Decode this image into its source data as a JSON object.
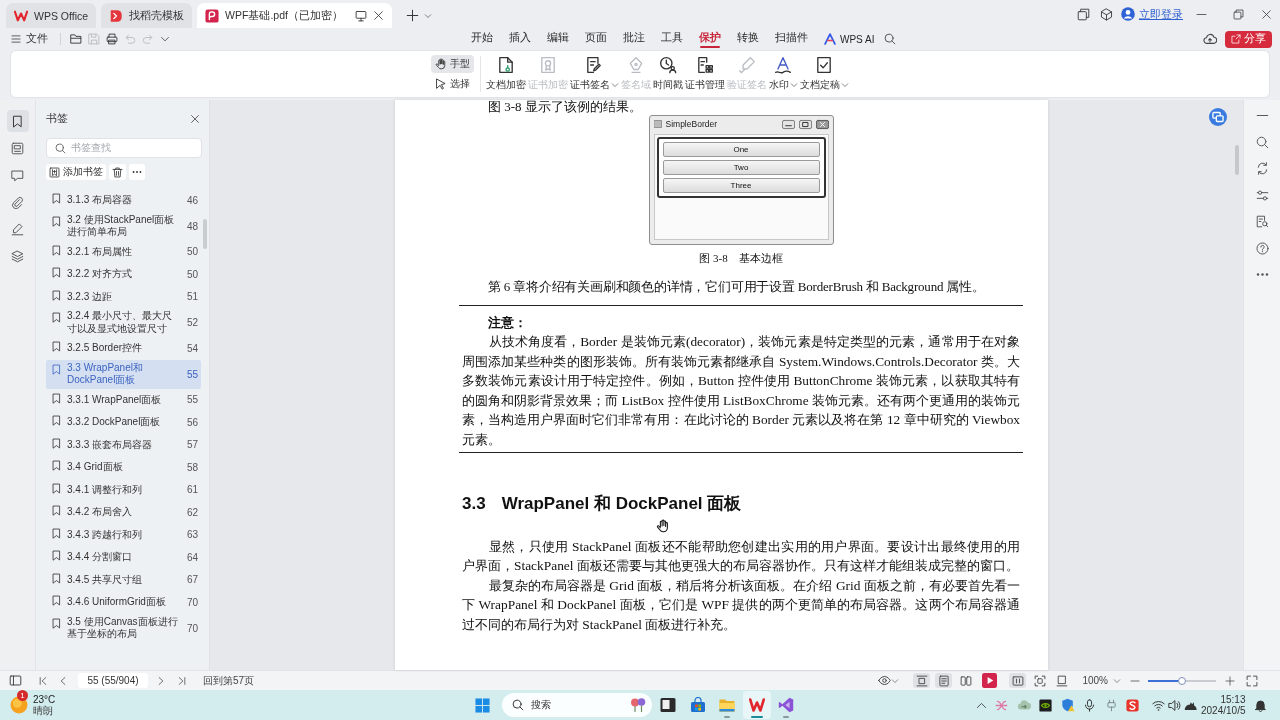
{
  "tabs": [
    {
      "kind": "home",
      "label": "WPS Office",
      "selected": false
    },
    {
      "kind": "template",
      "label": "找稻壳模板",
      "selected": false
    },
    {
      "kind": "pdf",
      "label": "WPF基础.pdf（已加密）",
      "selected": true
    }
  ],
  "account": {
    "login": "立即登录"
  },
  "menu": {
    "file": "文件",
    "quick_tools": [
      {
        "kind": "open",
        "disabled": false
      },
      {
        "kind": "save",
        "disabled": true
      },
      {
        "kind": "print",
        "disabled": false
      },
      {
        "kind": "undo",
        "disabled": true
      },
      {
        "kind": "redo",
        "disabled": true
      }
    ],
    "ribbon_tabs": [
      {
        "label": "开始",
        "selected": false
      },
      {
        "label": "插入",
        "selected": false
      },
      {
        "label": "编辑",
        "selected": false
      },
      {
        "label": "页面",
        "selected": false
      },
      {
        "label": "批注",
        "selected": false
      },
      {
        "label": "工具",
        "selected": false
      },
      {
        "label": "保护",
        "selected": true
      },
      {
        "label": "转换",
        "selected": false
      },
      {
        "label": "扫描件",
        "selected": false
      }
    ],
    "ai": "WPS AI",
    "share": "分享"
  },
  "ribbon": {
    "pointer_tools": [
      {
        "kind": "hand",
        "label": "手型",
        "selected": true
      },
      {
        "kind": "select",
        "label": "选择",
        "selected": false
      }
    ],
    "tools": [
      {
        "kind": "encrypt",
        "label": "文档加密",
        "disabled": false,
        "dropdown": false
      },
      {
        "kind": "cert-encrypt",
        "label": "证书加密",
        "disabled": true,
        "dropdown": false
      },
      {
        "kind": "cert-sign",
        "label": "证书签名",
        "disabled": false,
        "dropdown": true
      },
      {
        "kind": "sign-field",
        "label": "签名域",
        "disabled": true,
        "dropdown": false
      },
      {
        "kind": "timestamp",
        "label": "时间戳",
        "disabled": false,
        "dropdown": false
      },
      {
        "kind": "cert-manage",
        "label": "证书管理",
        "disabled": false,
        "dropdown": false
      },
      {
        "kind": "verify",
        "label": "验证签名",
        "disabled": true,
        "dropdown": false
      },
      {
        "kind": "watermark",
        "label": "水印",
        "disabled": false,
        "dropdown": true
      },
      {
        "kind": "finalize",
        "label": "文档定稿",
        "disabled": false,
        "dropdown": true
      }
    ]
  },
  "sidebar": {
    "rail": [
      {
        "kind": "bookmarks",
        "selected": true
      },
      {
        "kind": "thumbnails",
        "selected": false
      },
      {
        "kind": "comments",
        "selected": false
      },
      {
        "kind": "attachments",
        "selected": false
      },
      {
        "kind": "signatures",
        "selected": false
      },
      {
        "kind": "layers",
        "selected": false
      }
    ],
    "panel": {
      "title": "书签",
      "search": {
        "placeholder": "书签查找"
      },
      "add_button": "添加书签",
      "bookmarks": [
        {
          "label": "3.1.3 布局容器",
          "page": "46",
          "selected": false
        },
        {
          "label": "3.2 使用StackPanel面板进行简单布局",
          "page": "48",
          "selected": false
        },
        {
          "label": "3.2.1 布局属性",
          "page": "50",
          "selected": false
        },
        {
          "label": "3.2.2 对齐方式",
          "page": "50",
          "selected": false
        },
        {
          "label": "3.2.3 边距",
          "page": "51",
          "selected": false
        },
        {
          "label": "3.2.4 最小尺寸、最大尺寸以及显式地设置尺寸",
          "page": "52",
          "selected": false
        },
        {
          "label": "3.2.5 Border控件",
          "page": "54",
          "selected": false
        },
        {
          "label": "3.3 WrapPanel和DockPanel面板",
          "page": "55",
          "selected": true
        },
        {
          "label": "3.3.1 WrapPanel面板",
          "page": "55",
          "selected": false
        },
        {
          "label": "3.3.2 DockPanel面板",
          "page": "56",
          "selected": false
        },
        {
          "label": "3.3.3 嵌套布局容器",
          "page": "57",
          "selected": false
        },
        {
          "label": "3.4 Grid面板",
          "page": "58",
          "selected": false
        },
        {
          "label": "3.4.1 调整行和列",
          "page": "61",
          "selected": false
        },
        {
          "label": "3.4.2 布局舍入",
          "page": "62",
          "selected": false
        },
        {
          "label": "3.4.3 跨越行和列",
          "page": "63",
          "selected": false
        },
        {
          "label": "3.4.4 分割窗口",
          "page": "64",
          "selected": false
        },
        {
          "label": "3.4.5 共享尺寸组",
          "page": "67",
          "selected": false
        },
        {
          "label": "3.4.6 UniformGrid面板",
          "page": "70",
          "selected": false
        },
        {
          "label": "3.5 使用Canvas面板进行基于坐标的布局",
          "page": "70",
          "selected": false
        }
      ]
    }
  },
  "document": {
    "intro": "图 3-8 显示了该例的结果。",
    "figure": {
      "title": "SimpleBorder",
      "buttons": [
        "One",
        "Two",
        "Three"
      ],
      "caption": "图 3-8　基本边框"
    },
    "paragraph": "第 6 章将介绍有关画刷和颜色的详情，它们可用于设置 BorderBrush 和 Background 属性。",
    "note": {
      "title": "注意：",
      "text": "从技术角度看，Border 是装饰元素(decorator)，装饰元素是特定类型的元素，通常用于在对象周围添加某些种类的图形装饰。所有装饰元素都继承自 System.Windows.Controls.Decorator 类。大多数装饰元素设计用于特定控件。例如，Button 控件使用 ButtonChrome 装饰元素，以获取其特有的圆角和阴影背景效果；而 ListBox 控件使用 ListBoxChrome 装饰元素。还有两个更通用的装饰元素，当构造用户界面时它们非常有用：在此讨论的 Border 元素以及将在第 12 章中研究的 Viewbox 元素。"
    },
    "heading": {
      "number": "3.3",
      "title": "WrapPanel 和 DockPanel 面板"
    },
    "paragraphs": [
      "显然，只使用 StackPanel 面板还不能帮助您创建出实用的用户界面。要设计出最终使用的用户界面，StackPanel 面板还需要与其他更强大的布局容器协作。只有这样才能组装成完整的窗口。",
      "最复杂的布局容器是 Grid 面板，稍后将分析该面板。在介绍 Grid 面板之前，有必要首先看一下 WrapPanel 和 DockPanel 面板，它们是 WPF 提供的两个更简单的布局容器。这两个布局容器通过不同的布局行为对 StackPanel 面板进行补充。"
    ]
  },
  "status_bar": {
    "page": "55 (55/904)",
    "goto": "回到第57页",
    "layout_buttons": [
      {
        "kind": "fit",
        "selected": true
      },
      {
        "kind": "single",
        "selected": true
      },
      {
        "kind": "double",
        "selected": false
      }
    ],
    "display_buttons": [
      {
        "kind": "columns",
        "selected": true
      },
      {
        "kind": "frame",
        "selected": false
      },
      {
        "kind": "page",
        "selected": false
      }
    ],
    "zoom": {
      "reading": "100%",
      "level": 0.5
    }
  },
  "taskbar": {
    "weather": {
      "badge": "1",
      "temperature": "23°C",
      "condition": "晴朗"
    },
    "search": {
      "placeholder": "搜索"
    },
    "apps": [
      {
        "kind": "terminal",
        "running": false,
        "selected": false
      },
      {
        "kind": "store",
        "running": false,
        "selected": false
      },
      {
        "kind": "files",
        "running": true,
        "selected": false
      },
      {
        "kind": "wps",
        "running": true,
        "selected": true
      },
      {
        "kind": "studio",
        "running": true,
        "selected": false
      }
    ],
    "clock": {
      "time": "15:13",
      "date": "2024/10/5"
    }
  }
}
